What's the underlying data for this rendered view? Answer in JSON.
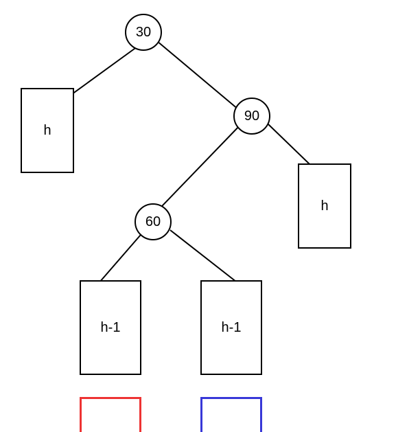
{
  "chart_data": {
    "type": "tree",
    "nodes": [
      {
        "id": "root",
        "value": "30",
        "shape": "circle"
      },
      {
        "id": "leftSub",
        "value": "h",
        "shape": "rect"
      },
      {
        "id": "right",
        "value": "90",
        "shape": "circle"
      },
      {
        "id": "rightRightSub",
        "value": "h",
        "shape": "rect"
      },
      {
        "id": "rightLeft",
        "value": "60",
        "shape": "circle"
      },
      {
        "id": "rlLeftSub",
        "value": "h-1",
        "shape": "rect"
      },
      {
        "id": "rlRightSub",
        "value": "h-1",
        "shape": "rect"
      }
    ],
    "edges": [
      {
        "from": "root",
        "to": "leftSub"
      },
      {
        "from": "root",
        "to": "right"
      },
      {
        "from": "right",
        "to": "rightRightSub"
      },
      {
        "from": "right",
        "to": "rightLeft"
      },
      {
        "from": "rightLeft",
        "to": "rlLeftSub"
      },
      {
        "from": "rightLeft",
        "to": "rlRightSub"
      }
    ],
    "title": "",
    "annotations": [
      {
        "target": "rlLeftSub",
        "color": "red"
      },
      {
        "target": "rlRightSub",
        "color": "blue"
      }
    ]
  },
  "labels": {
    "root": "30",
    "right": "90",
    "rightLeft": "60",
    "leftSub": "h",
    "rightRightSub": "h",
    "rlLeftSub": "h-1",
    "rlRightSub": "h-1"
  }
}
